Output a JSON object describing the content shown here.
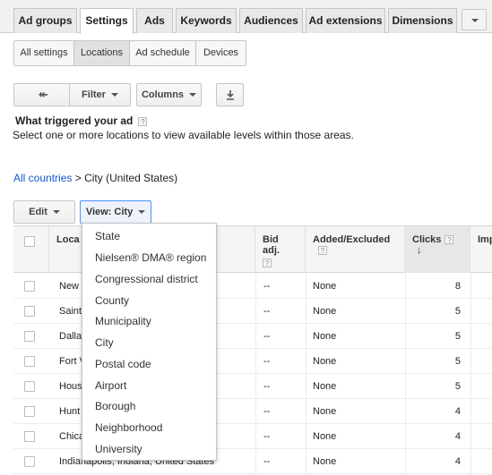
{
  "tabs": [
    {
      "label": "Ad groups",
      "active": false
    },
    {
      "label": "Settings",
      "active": true
    },
    {
      "label": "Ads",
      "active": false
    },
    {
      "label": "Keywords",
      "active": false
    },
    {
      "label": "Audiences",
      "active": false
    },
    {
      "label": "Ad extensions",
      "active": false
    },
    {
      "label": "Dimensions",
      "active": false
    }
  ],
  "subtabs": [
    {
      "label": "All settings",
      "active": false
    },
    {
      "label": "Locations",
      "active": true
    },
    {
      "label": "Ad schedule",
      "active": false
    },
    {
      "label": "Devices",
      "active": false
    }
  ],
  "toolbar": {
    "back_icon": "back-arrow-icon",
    "filter_label": "Filter",
    "columns_label": "Columns",
    "download_icon": "download-icon"
  },
  "section": {
    "title": "What triggered your ad",
    "help": "?",
    "description": "Select one or more locations to view available levels within those areas."
  },
  "breadcrumb": {
    "link": "All countries",
    "separator": ">",
    "current": "City (United States)"
  },
  "actions": {
    "edit_label": "Edit",
    "view_label": "View: City"
  },
  "table": {
    "headers": {
      "location": "Loca",
      "bid_adj": "Bid adj.",
      "added_excluded": "Added/Excluded",
      "clicks": "Clicks",
      "impr": "Imp",
      "help": "?"
    },
    "sort_icon": "arrow-down-icon",
    "rows": [
      {
        "location": "New",
        "bid_adj": "--",
        "added_excluded": "None",
        "clicks": "8"
      },
      {
        "location": "Saint",
        "bid_adj": "--",
        "added_excluded": "None",
        "clicks": "5"
      },
      {
        "location": "Dalla",
        "bid_adj": "--",
        "added_excluded": "None",
        "clicks": "5"
      },
      {
        "location": "Fort V",
        "bid_adj": "--",
        "added_excluded": "None",
        "clicks": "5"
      },
      {
        "location": "Hous",
        "bid_adj": "--",
        "added_excluded": "None",
        "clicks": "5"
      },
      {
        "location": "Hunt",
        "bid_adj": "--",
        "added_excluded": "None",
        "clicks": "4"
      },
      {
        "location": "Chica",
        "bid_adj": "--",
        "added_excluded": "None",
        "clicks": "4"
      },
      {
        "location": "Indianapolis, Indiana, United States",
        "bid_adj": "--",
        "added_excluded": "None",
        "clicks": "4"
      }
    ]
  },
  "view_dropdown": {
    "options": [
      "State",
      "Nielsen® DMA® region",
      "Congressional district",
      "County",
      "Municipality",
      "City",
      "Postal code",
      "Airport",
      "Borough",
      "Neighborhood",
      "University"
    ]
  },
  "colors": {
    "link": "#1155cc",
    "active_border": "#4d90fe",
    "header_bg": "#f5f5f5"
  }
}
